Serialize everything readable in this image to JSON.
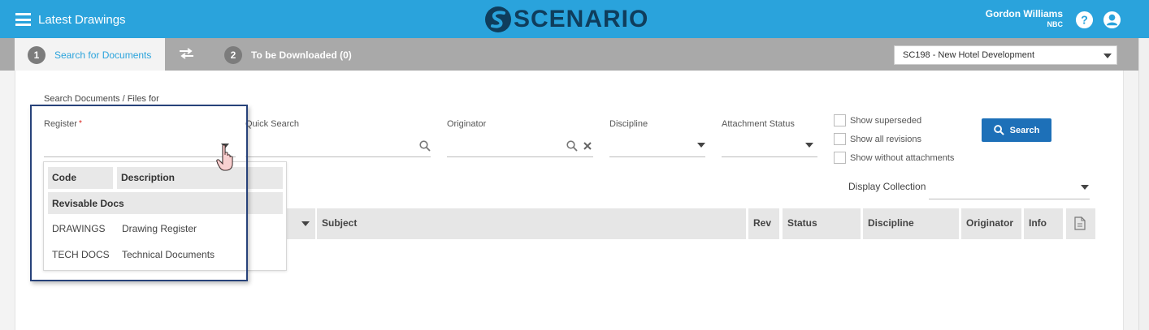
{
  "header": {
    "app_title": "Latest Drawings",
    "logo_text": "SCENARIO",
    "user_name": "Gordon Williams",
    "user_org": "NBC",
    "brand_color": "#2aa3dc",
    "logo_color": "#0f3d5c"
  },
  "tabs": [
    {
      "step": "1",
      "label": "Search for Documents",
      "active": true
    },
    {
      "step": "2",
      "label": "To be Downloaded (0)",
      "active": false
    }
  ],
  "project_select": {
    "value": "SC198 - New Hotel Development"
  },
  "search": {
    "heading": "Search Documents / Files for",
    "register_label": "Register",
    "required_marker": "*",
    "register_value": "",
    "quick_search_label": "Quick Search",
    "quick_search_value": "",
    "originator_label": "Originator",
    "originator_value": "",
    "discipline_label": "Discipline",
    "discipline_value": "",
    "attachment_status_label": "Attachment Status",
    "attachment_status_value": "",
    "checkboxes": [
      {
        "label": "Show superseded",
        "checked": false
      },
      {
        "label": "Show all revisions",
        "checked": false
      },
      {
        "label": "Show without attachments",
        "checked": false
      }
    ],
    "search_button": "Search",
    "search_button_color": "#1d70b8",
    "display_collection_label": "Display Collection",
    "display_collection_value": ""
  },
  "results_table": {
    "columns": [
      "Subject",
      "Rev",
      "Status",
      "Discipline",
      "Originator",
      "Info"
    ]
  },
  "register_dropdown": {
    "headers": {
      "code": "Code",
      "description": "Description"
    },
    "group": "Revisable Docs",
    "items": [
      {
        "code": "DRAWINGS",
        "description": "Drawing Register"
      },
      {
        "code": "TECH DOCS",
        "description": "Technical Documents"
      }
    ]
  },
  "icons": [
    "menu-icon",
    "swap-icon",
    "help-icon",
    "user-icon",
    "search-icon",
    "clear-icon",
    "chevron-down-icon",
    "document-icon",
    "hand-cursor-icon"
  ]
}
